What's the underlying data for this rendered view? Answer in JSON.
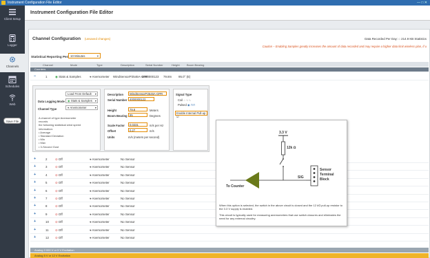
{
  "window": {
    "title": "Instrument Configuration File Editor",
    "controls": "— □ ✕"
  },
  "sidebar": {
    "items": [
      {
        "label": "Client Setup"
      },
      {
        "label": "Logger"
      },
      {
        "label": "Channels"
      },
      {
        "label": "Schedules"
      },
      {
        "label": "Web"
      }
    ],
    "save_label": "Save File"
  },
  "header": {
    "title": "Instrument Configuration File Editor"
  },
  "channel_config": {
    "title": "Channel Configuration",
    "changed": "(unsaved changes)",
    "data_recorded": "Data Recorded Per Day: ○ 214.9 KB  Statistics",
    "caution": "Caution – Enabling Samples greatly increases the amount of data recorded and may require a higher data limit wireless plan, if u",
    "stat_period_label": "Statistical Reporting Period",
    "stat_period_value": "10 Minutes"
  },
  "table": {
    "headers": [
      "Channel",
      "Mode",
      "Type",
      "Description",
      "Serial Number",
      "Height",
      "Boom Bearing"
    ],
    "group": "Counters",
    "first_row": {
      "num": "1",
      "mode": "Stats & Samples",
      "type": "Anemometer",
      "description": "WindSensorP2546A-OPR",
      "serial": "4000000123",
      "height": "79.8m",
      "bearing": "95.0° (E)"
    },
    "rows": [
      {
        "num": "2",
        "mode": "Off",
        "type": "Anemometer",
        "description": "No Sensor"
      },
      {
        "num": "3",
        "mode": "Off",
        "type": "Anemometer",
        "description": "No Sensor"
      },
      {
        "num": "4",
        "mode": "Off",
        "type": "Anemometer",
        "description": "No Sensor"
      },
      {
        "num": "5",
        "mode": "Off",
        "type": "Anemometer",
        "description": "No Sensor"
      },
      {
        "num": "6",
        "mode": "Off",
        "type": "Anemometer",
        "description": "No Sensor"
      },
      {
        "num": "7",
        "mode": "Off",
        "type": "Anemometer",
        "description": "No Sensor"
      },
      {
        "num": "8",
        "mode": "Off",
        "type": "Anemometer",
        "description": "No Sensor"
      },
      {
        "num": "9",
        "mode": "Off",
        "type": "Anemometer",
        "description": "No Sensor"
      },
      {
        "num": "10",
        "mode": "Off",
        "type": "Anemometer",
        "description": "No Sensor"
      },
      {
        "num": "11",
        "mode": "Off",
        "type": "Anemometer",
        "description": "No Sensor"
      },
      {
        "num": "12",
        "mode": "Off",
        "type": "Anemometer",
        "description": "No Sensor"
      }
    ],
    "analog_a": "Analog 2.000 V or 5 V Excitation",
    "analog_b": "Analog 5 V or 12 V Excitation"
  },
  "detail": {
    "load_from_default": "Load From Default",
    "data_logging_mode_label": "Data Logging Mode",
    "data_logging_mode_value": "Stats & Samples",
    "channel_type_label": "Channel Type",
    "channel_type_value": "Anemometer",
    "channel_desc": "A channel of type Anemometer records\nthe following statistical wind speed\ninformation:\n• Average\n• Standard Deviation\n• Min\n• Max\n• 3-Second Gust",
    "description_label": "Description",
    "description_value": "WindSensorP2546A-OPR",
    "serial_label": "Serial Number",
    "serial_value": "4000000123",
    "height_label": "Height",
    "height_value": "79.8",
    "height_unit": "Meters",
    "boom_label": "Boom Bearing",
    "boom_value": "95",
    "boom_unit": "Degrees",
    "scale_label": "Scale Factor",
    "scale_value": "0.0231",
    "scale_unit": "m/s per Hz",
    "offset_label": "Offset",
    "offset_value": "0.27",
    "offset_unit": "m/s",
    "units_label": "Units",
    "units_value": "m/s (meters per second)",
    "signal_type_label": "Signal Type",
    "signal_coil": "Coil",
    "signal_pulsed": "Pulsed",
    "pullup_label": "Enable Internal Pull-up"
  },
  "popup": {
    "voltage": "3.3 V",
    "resistor": "12k Ω",
    "sig": "SIG",
    "sensor_block": [
      "Sensor",
      "Terminal",
      "Block"
    ],
    "to_counter": "To Counter",
    "note1": "When this option is selected, the switch in the above circuit is closed and the 12 kΩ pull-up resistor to the 3.3 V supply is enabled.",
    "note2": "This circuit is typically used for measuring anemometers that use switch closures and eliminates the need for any external circuitry."
  }
}
